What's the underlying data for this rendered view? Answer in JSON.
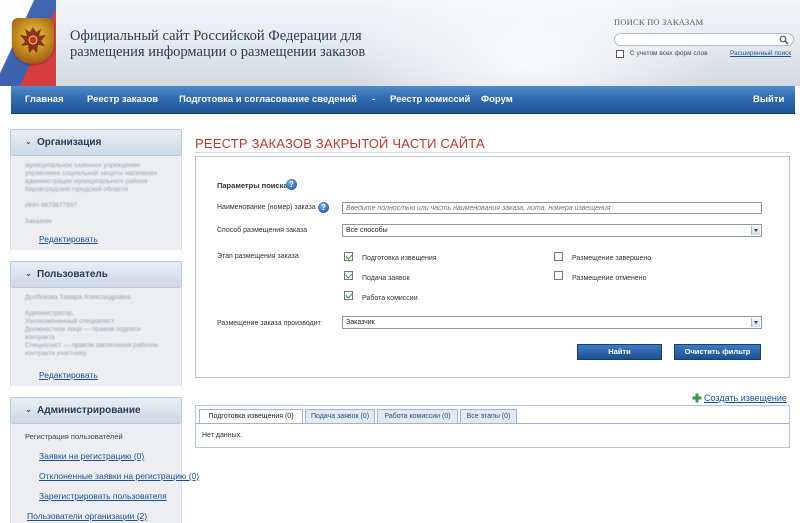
{
  "header": {
    "site_title": "Официальный сайт Российской Федерации для размещения информации о размещении заказов",
    "search_label": "ПОИСК ПО ЗАКАЗАМ",
    "search_value": "",
    "all_forms_label": "С учетом всех форм слов",
    "advanced_search": "Расширенный поиск"
  },
  "nav": {
    "items": [
      "Главная",
      "Реестр заказов",
      "Подготовка и согласование сведений",
      "Реестр комиссий",
      "Форум"
    ],
    "separator": "-",
    "logout": "Выйти"
  },
  "sidebar": {
    "organization": {
      "title": "Организация",
      "blurred_lines": [
        "муниципальное казенное учреждение",
        "управление социальной защиты населения",
        "администрации муниципального района",
        "Кировградский городской области",
        "",
        "ИНН 6670877897",
        "",
        "Заказчик"
      ],
      "edit": "Редактировать"
    },
    "user": {
      "title": "Пользователь",
      "blurred_lines": [
        "Долбокова Тамара Александровна",
        "",
        "Администратор,",
        "Уполномоченный специалист",
        "Должностное лицо — правом подписи",
        "контракта",
        "Специалист — правом заключения рабочих",
        "контракта участнику"
      ],
      "edit": "Редактировать"
    },
    "admin": {
      "title": "Администрирование",
      "section_label": "Регистрация пользователей",
      "items": [
        "Заявки на регистрацию (0)",
        "Отклоненные заявки на регистрацию (0)",
        "Зарегистрировать пользователя"
      ],
      "org_users": "Пользователи организации (2)"
    }
  },
  "main": {
    "page_title": "РЕЕСТР ЗАКАЗОВ ЗАКРЫТОЙ ЧАСТИ САЙТА",
    "params_title": "Параметры поиска",
    "order_name_label": "Наименование (номер) заказа",
    "order_name_placeholder": "Введите полностью или часть наименования заказа, лота, номера извещения",
    "method_label": "Способ размещения заказа",
    "method_value": "Все способы",
    "stage_label": "Этап размещения заказа",
    "stages_left": [
      {
        "label": "Подготовка извещения",
        "checked": true
      },
      {
        "label": "Подача заявок",
        "checked": true
      },
      {
        "label": "Работа комиссии",
        "checked": true
      }
    ],
    "stages_right": [
      {
        "label": "Размещение завершено",
        "checked": false
      },
      {
        "label": "Размещение отменено",
        "checked": false
      }
    ],
    "placer_label": "Размещение заказа производит",
    "placer_value": "Заказчик",
    "find_button": "Найти",
    "clear_button": "Очистить фильтр",
    "create_link": "Создать извещение",
    "tabs": [
      "Подготовка извещения (0)",
      "Подача заявок (0)",
      "Работа комиссии (0)",
      "Все этапы (0)"
    ],
    "no_data": "Нет данных."
  }
}
